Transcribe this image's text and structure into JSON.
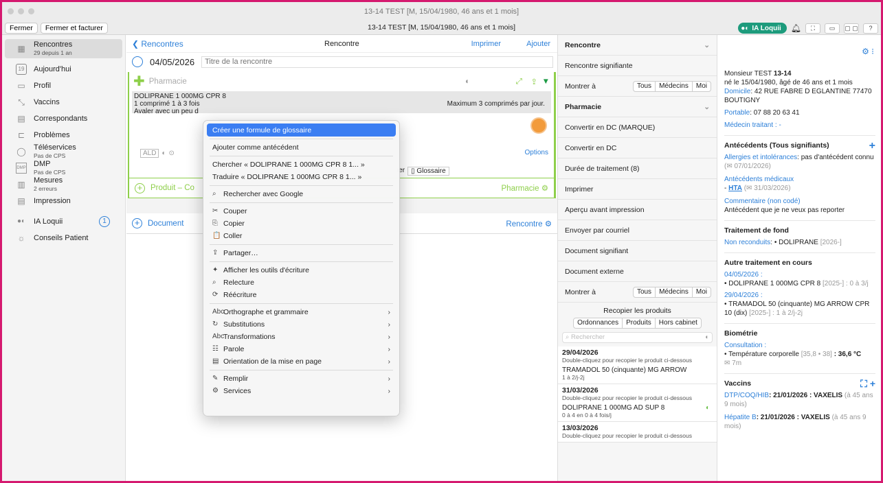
{
  "window": {
    "title": "13-14 TEST [M, 15/04/1980, 46 ans et 1 mois]"
  },
  "toolbar": {
    "close": "Fermer",
    "close_invoice": "Fermer et facturer",
    "ia": "IA Loquii",
    "help": "?"
  },
  "sidebar": {
    "items": [
      {
        "label": "Rencontres",
        "sub": "29 depuis 1 an"
      },
      {
        "label": "Aujourd'hui"
      },
      {
        "label": "Profil"
      },
      {
        "label": "Vaccins"
      },
      {
        "label": "Correspondants"
      },
      {
        "label": "Problèmes"
      },
      {
        "label": "Téléservices",
        "sub": "Pas de CPS"
      },
      {
        "label": "DMP",
        "sub": "Pas de CPS"
      },
      {
        "label": "Mesures",
        "sub": "2 erreurs"
      },
      {
        "label": "Impression"
      },
      {
        "label": "IA Loquii",
        "badge": "1"
      },
      {
        "label": "Conseils Patient"
      }
    ]
  },
  "main": {
    "back": "Rencontres",
    "title": "Rencontre",
    "print": "Imprimer",
    "add": "Ajouter",
    "date": "04/05/2026",
    "title_placeholder": "Titre de la rencontre",
    "pharmacy_label": "Pharmacie",
    "rx_name": "DOLIPRANE 1 000MG CPR 8",
    "rx_line1": "1 comprimé 1 à 3 fois",
    "rx_line1_end": "Maximum 3 comprimés par jour.",
    "rx_line2": "Avaler avec un peu d",
    "ald": "ALD",
    "options": "Options",
    "glossary_hint": "ier",
    "glossary": "Glossaire",
    "product_row": "Produit  –  Co",
    "pharmacy_right": "Pharmacie",
    "document_row": "Document",
    "rencontre_right": "Rencontre"
  },
  "context_menu": {
    "items": [
      {
        "label": "Créer une formule de glossaire",
        "selected": true
      },
      {
        "sep": true
      },
      {
        "label": "Ajouter comme antécédent"
      },
      {
        "sep": true
      },
      {
        "label": "Chercher « DOLIPRANE 1 000MG CPR 8 1... »"
      },
      {
        "label": "Traduire « DOLIPRANE 1 000MG CPR 8 1... »"
      },
      {
        "sep": true
      },
      {
        "label": "Rechercher avec Google",
        "icon": "⌕"
      },
      {
        "sep": true
      },
      {
        "label": "Couper",
        "icon": "✂"
      },
      {
        "label": "Copier",
        "icon": "⎘"
      },
      {
        "label": "Coller",
        "icon": "📋"
      },
      {
        "sep": true
      },
      {
        "label": "Partager…",
        "icon": "⇪"
      },
      {
        "sep": true
      },
      {
        "label": "Afficher les outils d'écriture",
        "icon": "✦"
      },
      {
        "label": "Relecture",
        "icon": "⌕"
      },
      {
        "label": "Réécriture",
        "icon": "⟳"
      },
      {
        "sep": true
      },
      {
        "label": "Orthographe et grammaire",
        "icon": "Abc",
        "sub": true
      },
      {
        "label": "Substitutions",
        "icon": "↻",
        "sub": true
      },
      {
        "label": "Transformations",
        "icon": "Abc",
        "sub": true
      },
      {
        "label": "Parole",
        "icon": "☷",
        "sub": true
      },
      {
        "label": "Orientation de la mise en page",
        "icon": "▤",
        "sub": true
      },
      {
        "sep": true
      },
      {
        "label": "Remplir",
        "icon": "✎",
        "sub": true
      },
      {
        "label": "Services",
        "icon": "⚙",
        "sub": true
      }
    ]
  },
  "mid": {
    "rencontre": "Rencontre",
    "significant": "Rencontre signifiante",
    "show_to": "Montrer à",
    "seg": [
      "Tous",
      "Médecins",
      "Moi"
    ],
    "pharmacie": "Pharmacie",
    "actions": [
      "Convertir en DC (MARQUE)",
      "Convertir en DC",
      "Durée de traitement (8)",
      "Imprimer",
      "Aperçu avant impression",
      "Envoyer par courriel",
      "Document signifiant",
      "Document externe"
    ],
    "copy_products": "Recopier les produits",
    "tabs": [
      "Ordonnances",
      "Produits",
      "Hors cabinet"
    ],
    "search_placeholder": "Rechercher",
    "history": [
      {
        "date": "29/04/2026",
        "hint": "Double-cliquez pour recopier le produit ci-dessous",
        "product": "TRAMADOL 50 (cinquante) MG ARROW",
        "dose": "1 à 2/j-2j"
      },
      {
        "date": "31/03/2026",
        "hint": "Double-cliquez pour recopier le produit ci-dessous",
        "product": "DOLIPRANE 1 000MG AD SUP 8",
        "dose": "0 à 4 en 0 à 4 fois/j"
      },
      {
        "date": "13/03/2026",
        "hint": "Double-cliquez pour recopier le produit ci-dessous",
        "product": "",
        "dose": ""
      }
    ]
  },
  "right": {
    "patient": "Monsieur TEST",
    "patient_bold": "13-14",
    "born": "né le 15/04/1980, âgé de 46 ans et 1 mois",
    "address_label": "Domicile",
    "address": ": 42 RUE FABRE D EGLANTINE 77470 BOUTIGNY",
    "phone_label": "Portable",
    "phone": ": 07 88 20 63 41",
    "doctor": "Médecin traitant : -",
    "antecedents_title": "Antécédents (Tous signifiants)",
    "allergy_label": "Allergies et intolérances",
    "allergy": ": pas d'antécédent connu",
    "allergy_date": "(✉ 07/01/2026)",
    "medical_label": "Antécédents médicaux",
    "hta": "HTA",
    "hta_date": "(✉ 31/03/2026)",
    "comment_label": "Commentaire (non codé)",
    "comment": "Antécédent que je ne veux pas reporter",
    "treatment_title": "Traitement de fond",
    "treatment_label": "Non reconduits",
    "treatment": ": • DOLIPRANE",
    "treatment_year": "[2026-]",
    "other_title": "Autre traitement en cours",
    "other1_date": "04/05/2026 :",
    "other1": "• DOLIPRANE 1 000MG CPR 8",
    "other1_meta": "[2025-] : 0 à 3/j",
    "other2_date": "29/04/2026 :",
    "other2": "• TRAMADOL 50 (cinquante) MG ARROW CPR 10 (dix)",
    "other2_meta": "[2025-] : 1 à 2/j-2j",
    "bio_title": "Biométrie",
    "bio_label": "Consultation :",
    "bio": "• Température corporelle",
    "bio_range": "[35,8 • 38]",
    "bio_value": ": 36,6 °C",
    "bio_ago": "✉ 7m",
    "vacc_title": "Vaccins",
    "vacc1_label": "DTP/COQ/HIB",
    "vacc1": ": 21/01/2026 : VAXELIS",
    "vacc1_age": "(à 45 ans 9 mois)",
    "vacc2_label": "Hépatite B",
    "vacc2": ": 21/01/2026 : VAXELIS",
    "vacc2_age": "(à 45 ans 9 mois)"
  }
}
